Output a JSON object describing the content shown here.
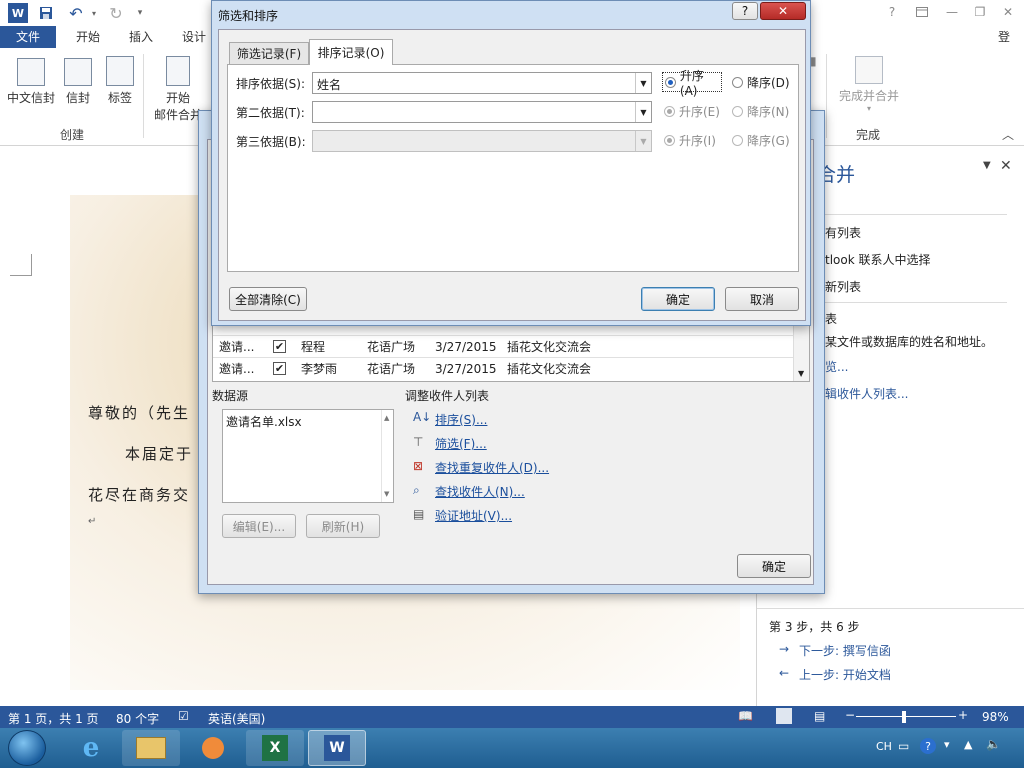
{
  "titlebar": {
    "qat": [
      "W",
      "save",
      "undo",
      "redo",
      "customize"
    ],
    "help": "?",
    "controls": [
      "ribbon-display",
      "minimize",
      "restore",
      "close"
    ]
  },
  "ribbon": {
    "tabs": [
      "文件",
      "开始",
      "插入",
      "设计"
    ],
    "login": "登录",
    "buttons": {
      "chinese_envelope": "中文信封",
      "envelope": "信封",
      "label": "标签",
      "start_merge_line1": "开始",
      "start_merge_line2": "邮件合并",
      "finish_merge": "完成并合并"
    },
    "groups": {
      "create": "创建",
      "finish": "完成"
    }
  },
  "document": {
    "line1": "尊敬的（先生",
    "line2": "本届定于",
    "line3": "花尽在商务交",
    "para_mark": "↵"
  },
  "taskpane": {
    "title": "合并",
    "items": [
      "有列表",
      "tlook 联系人中选择",
      "新列表"
    ],
    "section": "表",
    "desc": "某文件或数据库的姓名和地址。",
    "browse": "览...",
    "edit_list": "辑收件人列表...",
    "step": "第 3 步，共 6 步",
    "next": "下一步: 撰写信函",
    "prev": "上一步: 开始文档"
  },
  "status": {
    "page": "第 1 页，共 1 页",
    "words": "80 个字",
    "lang": "英语(美国)",
    "zoom": "98%"
  },
  "taskbar": {
    "tray_lang": "CH"
  },
  "recipients": {
    "rows": [
      {
        "source": "邀请...",
        "checked": true,
        "name": "程程",
        "place": "花语广场",
        "date": "3/27/2015",
        "event": "插花文化交流会"
      },
      {
        "source": "邀请...",
        "checked": true,
        "name": "李梦雨",
        "place": "花语广场",
        "date": "3/27/2015",
        "event": "插花文化交流会"
      }
    ],
    "datasource_label": "数据源",
    "datasource_file": "邀请名单.xlsx",
    "edit_btn": "编辑(E)...",
    "refresh_btn": "刷新(H)",
    "adjust_label": "调整收件人列表",
    "links": [
      "排序(S)...",
      "筛选(F)...",
      "查找重复收件人(D)...",
      "查找收件人(N)...",
      "验证地址(V)..."
    ],
    "ok": "确定"
  },
  "sortdlg": {
    "title": "筛选和排序",
    "help": "?",
    "tabs": [
      "筛选记录(F)",
      "排序记录(O)"
    ],
    "row1": {
      "label": "排序依据(S):",
      "value": "姓名",
      "asc": "升序(A)",
      "desc": "降序(D)"
    },
    "row2": {
      "label": "第二依据(T):",
      "value": "",
      "asc": "升序(E)",
      "desc": "降序(N)"
    },
    "row3": {
      "label": "第三依据(B):",
      "value": "",
      "asc": "升序(I)",
      "desc": "降序(G)"
    },
    "clear_all": "全部清除(C)",
    "ok": "确定",
    "cancel": "取消"
  },
  "colors": {
    "accent": "#2b579a",
    "link": "#1a4e9c",
    "dialog_frame": "#cfe0f3"
  }
}
